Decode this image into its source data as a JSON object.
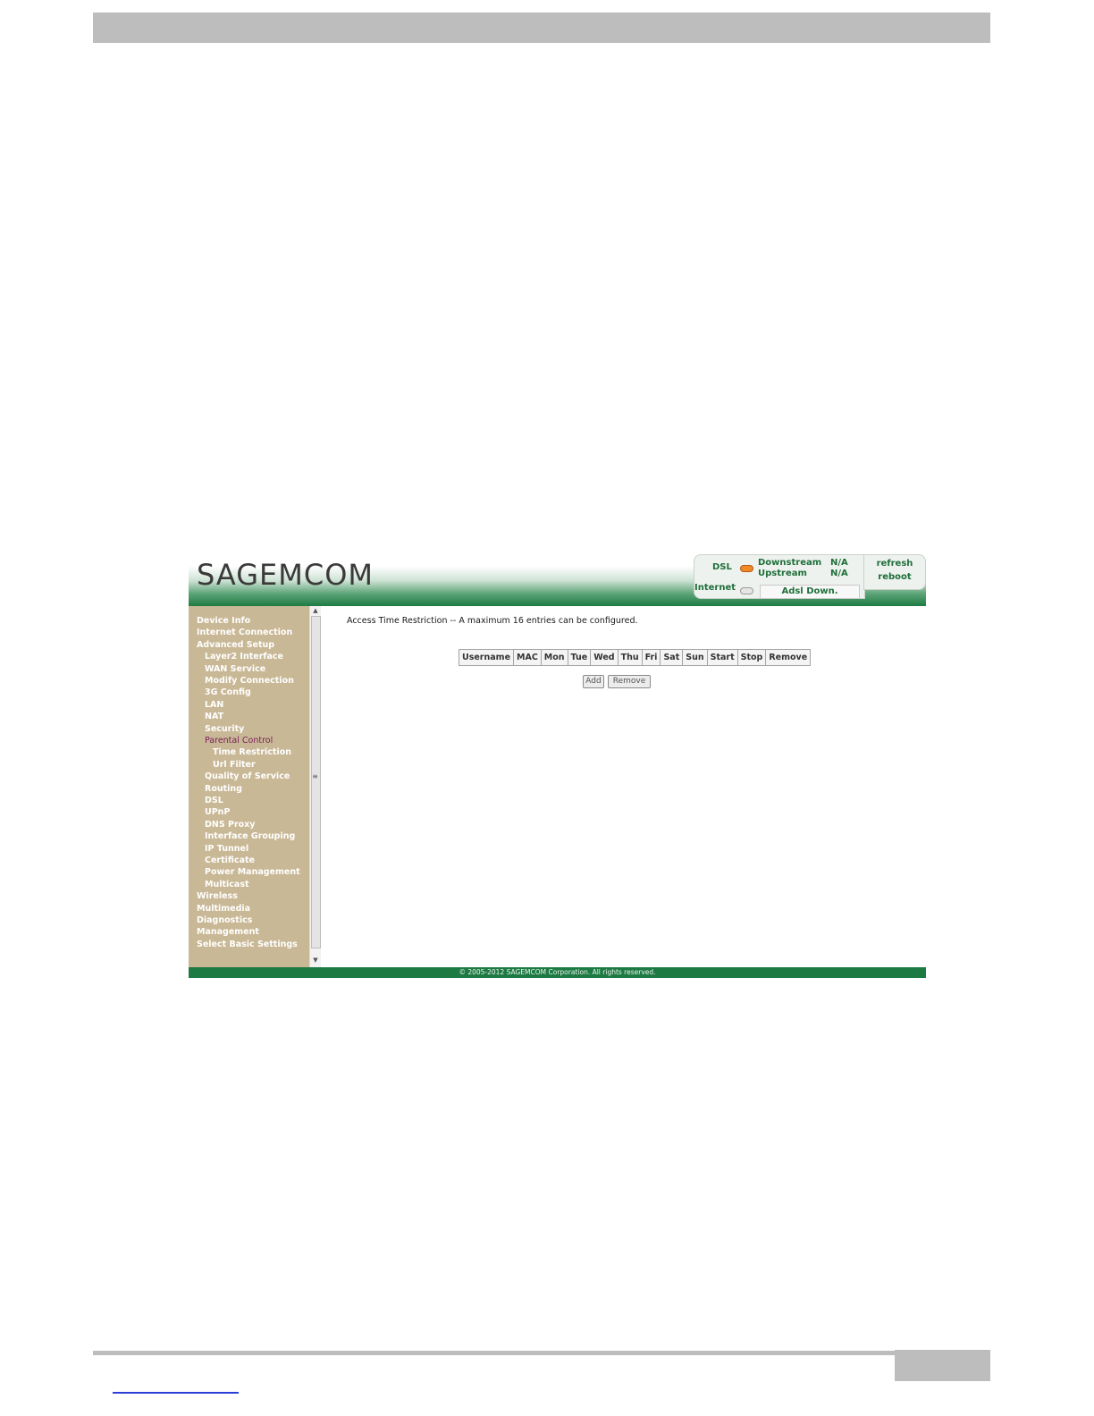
{
  "brand": {
    "logo_text": "SAGEMCOM"
  },
  "status": {
    "dsl_label": "DSL",
    "downstream_label": "Downstream",
    "upstream_label": "Upstream",
    "downstream_value": "N/A",
    "upstream_value": "N/A",
    "internet_label": "Internet",
    "adsl_status": "Adsl Down.",
    "dsl_led_color": "#f08a24",
    "internet_led_color": "#e5e5e5"
  },
  "actions": {
    "refresh": "refresh",
    "reboot": "reboot"
  },
  "sidebar": {
    "items": [
      {
        "label": "Device Info",
        "level": 0
      },
      {
        "label": "Internet Connection",
        "level": 0
      },
      {
        "label": "Advanced Setup",
        "level": 0
      },
      {
        "label": "Layer2 Interface",
        "level": 1
      },
      {
        "label": "WAN Service",
        "level": 1
      },
      {
        "label": "Modify Connection",
        "level": 1
      },
      {
        "label": "3G Config",
        "level": 1
      },
      {
        "label": "LAN",
        "level": 1
      },
      {
        "label": "NAT",
        "level": 1
      },
      {
        "label": "Security",
        "level": 1
      },
      {
        "label": "Parental Control",
        "level": 1,
        "active": true
      },
      {
        "label": "Time Restriction",
        "level": 2
      },
      {
        "label": "Url Filter",
        "level": 2
      },
      {
        "label": "Quality of Service",
        "level": 1
      },
      {
        "label": "Routing",
        "level": 1
      },
      {
        "label": "DSL",
        "level": 1
      },
      {
        "label": "UPnP",
        "level": 1
      },
      {
        "label": "DNS Proxy",
        "level": 1
      },
      {
        "label": "Interface Grouping",
        "level": 1
      },
      {
        "label": "IP Tunnel",
        "level": 1
      },
      {
        "label": "Certificate",
        "level": 1
      },
      {
        "label": "Power Management",
        "level": 1
      },
      {
        "label": "Multicast",
        "level": 1
      },
      {
        "label": "Wireless",
        "level": 0
      },
      {
        "label": "Multimedia",
        "level": 0
      },
      {
        "label": "Diagnostics",
        "level": 0
      },
      {
        "label": "Management",
        "level": 0
      },
      {
        "label": "Select Basic Settings",
        "level": 0
      }
    ]
  },
  "main": {
    "heading": "Access Time Restriction -- A maximum 16 entries can be configured.",
    "table_headers": [
      "Username",
      "MAC",
      "Mon",
      "Tue",
      "Wed",
      "Thu",
      "Fri",
      "Sat",
      "Sun",
      "Start",
      "Stop",
      "Remove"
    ],
    "add_button": "Add",
    "remove_button": "Remove"
  },
  "footer": {
    "copyright": "© 2005-2012 SAGEMCOM Corporation. All rights reserved."
  }
}
